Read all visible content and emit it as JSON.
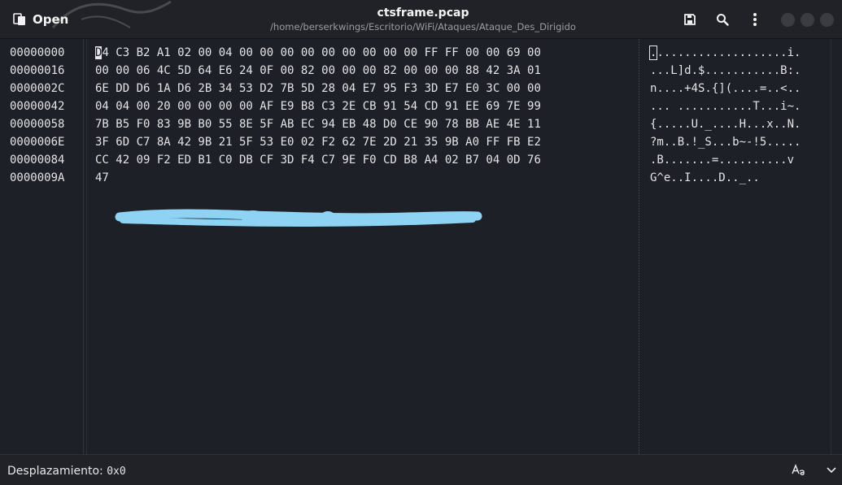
{
  "header": {
    "open_label": "Open",
    "title": "ctsframe.pcap",
    "path": "/home/berserkwings/Escritorio/WiFi/Ataques/Ataque_Des_Dirigido"
  },
  "offsets": [
    "00000000",
    "00000016",
    "0000002C",
    "00000042",
    "00000058",
    "0000006E",
    "00000084",
    "0000009A"
  ],
  "hex_rows": [
    "D4 C3 B2 A1 02 00 04 00 00 00 00 00 00 00 00 00 FF FF 00 00 69 00",
    "00 00 06 4C 5D 64 E6 24 0F 00 82 00 00 00 82 00 00 00 88 42 3A 01",
    "6E DD D6 1A D6 2B 34 53 D2 7B 5D 28 04 E7 95 F3 3D E7 E0 3C 00 00",
    "04 04 00 20 00 00 00 00 AF E9 B8 C3 2E CB 91 54 CD 91 EE 69 7E 99",
    "7B B5 F0 83 9B B0 55 8E 5F AB EC 94 EB 48 D0 CE 90 78 BB AE 4E 11",
    "3F 6D C7 8A 42 9B 21 5F 53 E0 02 F2 62 7E 2D 21 35 9B A0 FF FB E2",
    "CC 42 09 F2 ED B1 C0 DB CF 3D F4 C7 9E F0 CD B8 A4 02 B7 04 0D 76",
    "47"
  ],
  "ascii_rows": [
    "....................i.",
    "...L]d.$...........B:.",
    "n....+4S.{](....=..<..",
    "... ...........T...i~.",
    "{.....U._....H...x..N.",
    "?m..B.!_S...b~-!5.....",
    ".B.......=..........v",
    "G^e..I....D.._.."
  ],
  "cursor": {
    "row": 0,
    "char": 0
  },
  "status": {
    "label": "Desplazamiento: ",
    "value": "0x0"
  },
  "icons": {
    "open": "document-open-icon",
    "save": "save-icon",
    "search": "search-icon",
    "menu": "kebab-menu-icon",
    "text_options": "text-options-icon",
    "dropdown": "chevron-down-icon"
  },
  "colors": {
    "background": "#1e2027",
    "header": "#202227",
    "text": "#e3e4e7",
    "redaction": "#8fd3f4"
  }
}
